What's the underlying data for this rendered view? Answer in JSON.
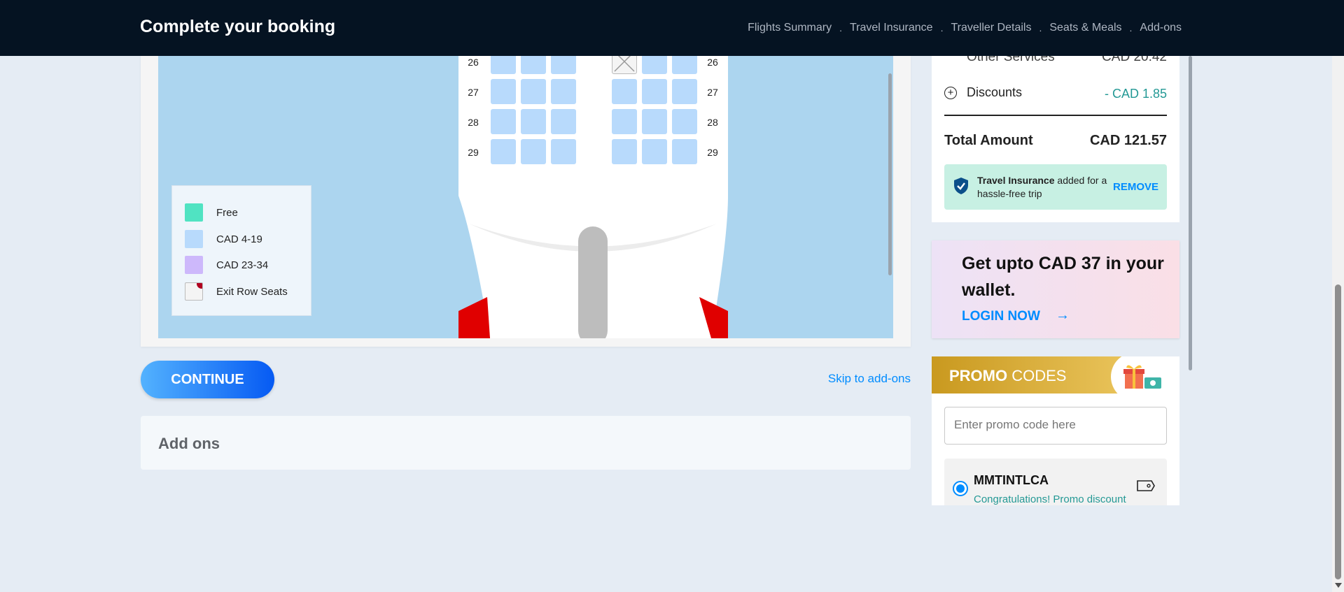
{
  "header": {
    "title": "Complete your booking",
    "steps": [
      "Flights Summary",
      "Travel Insurance",
      "Traveller Details",
      "Seats & Meals",
      "Add-ons"
    ],
    "separator": "."
  },
  "seatmap": {
    "rows": [
      "26",
      "27",
      "28",
      "29"
    ],
    "legend": [
      {
        "label": "Free",
        "color": "#50e3c2"
      },
      {
        "label": "CAD 4-19",
        "color": "#b8dafc"
      },
      {
        "label": "CAD 23-34",
        "color": "#cdb8fb"
      },
      {
        "label": "Exit Row Seats",
        "color": "#f4f4f4"
      }
    ]
  },
  "actions": {
    "continue": "CONTINUE",
    "skip": "Skip to add-ons"
  },
  "addons": {
    "title": "Add ons"
  },
  "fare": {
    "other_services": {
      "label": "Other Services",
      "value": "CAD 20.42"
    },
    "discounts": {
      "label": "Discounts",
      "value": "- CAD 1.85"
    },
    "total": {
      "label": "Total Amount",
      "value": "CAD 121.57"
    },
    "insurance": {
      "bold": "Travel Insurance",
      "text": " added for a hassle-free trip",
      "action": "REMOVE"
    }
  },
  "wallet": {
    "headline": "Get upto CAD 37 in your wallet.",
    "login": "LOGIN NOW"
  },
  "promo": {
    "title_bold": "PROMO",
    "title_rest": " CODES",
    "placeholder": "Enter promo code here",
    "coupon_code": "MMTINTLCA",
    "coupon_msg": "Congratulations! Promo discount"
  },
  "colors": {
    "header_bg": "#051322",
    "accent": "#008cff",
    "seat": "#b8dafc",
    "map_bg": "#acd5ef"
  }
}
